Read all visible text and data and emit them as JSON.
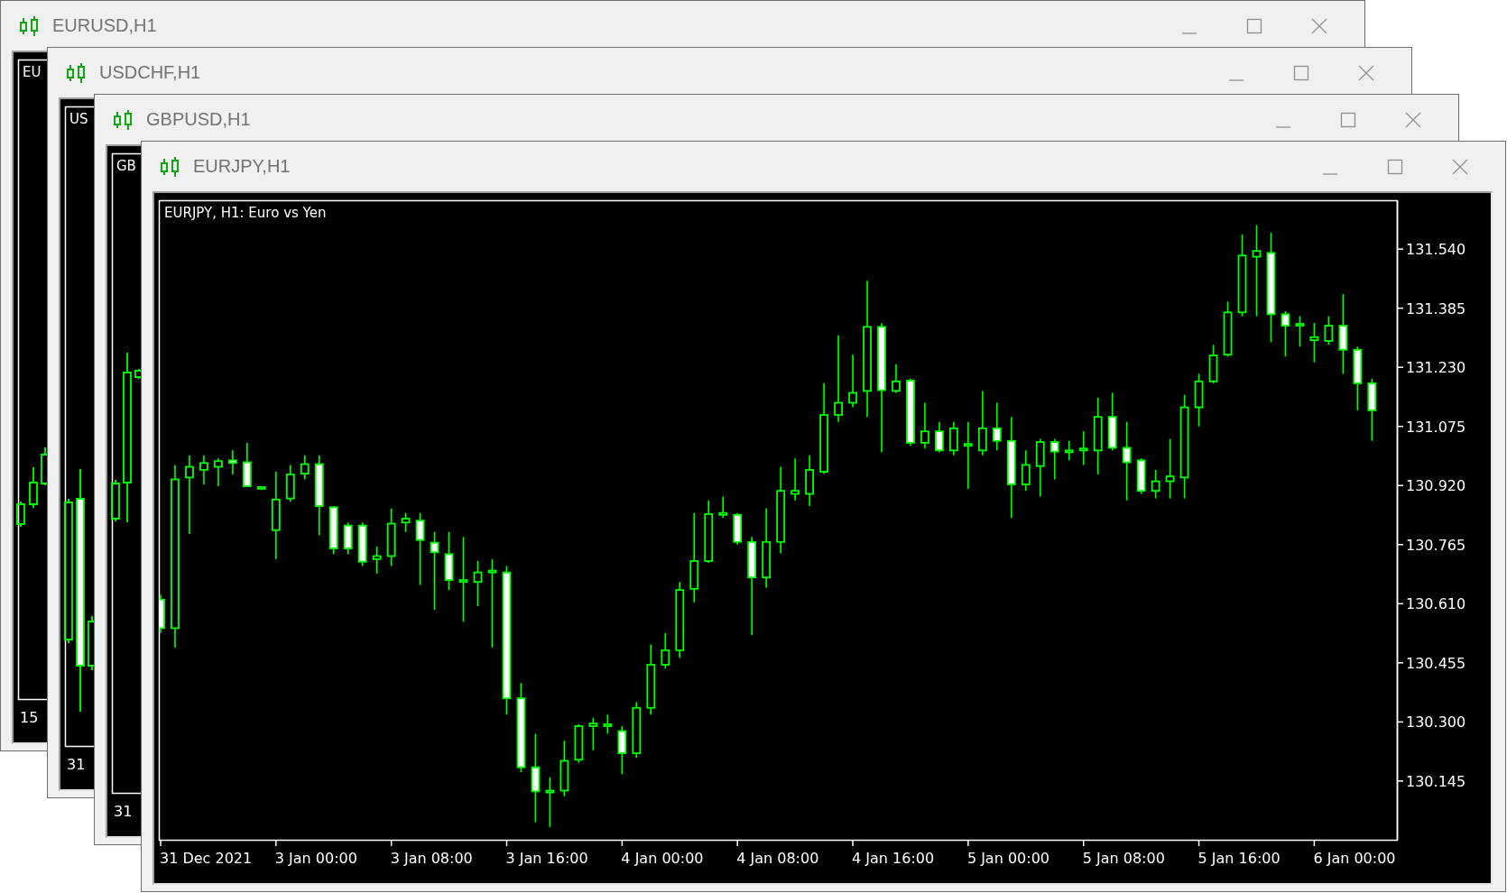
{
  "windows": [
    {
      "title": "EURUSD,H1",
      "chart_label": "EU",
      "date_label": "15"
    },
    {
      "title": "USDCHF,H1",
      "chart_label": "US",
      "date_label": "31"
    },
    {
      "title": "GBPUSD,H1",
      "chart_label": "GB",
      "date_label": "31"
    },
    {
      "title": "EURJPY,H1",
      "time_labels": [
        "31 Dec 2021",
        "3 Jan 00:00",
        "3 Jan 08:00",
        "3 Jan 16:00",
        "4 Jan 00:00",
        "4 Jan 08:00",
        "4 Jan 16:00",
        "5 Jan 00:00",
        "5 Jan 08:00",
        "5 Jan 16:00",
        "6 Jan 00:00"
      ],
      "chart_data": {
        "type": "candlestick",
        "title": "EURJPY, H1: Euro vs Yen",
        "ylim": [
          129.991,
          131.668
        ],
        "yticks": [
          {
            "value": 131.54,
            "label": "131.540"
          },
          {
            "value": 131.385,
            "label": "131.385"
          },
          {
            "value": 131.23,
            "label": "131.230"
          },
          {
            "value": 131.075,
            "label": "131.075"
          },
          {
            "value": 130.92,
            "label": "130.920"
          },
          {
            "value": 130.765,
            "label": "130.765"
          },
          {
            "value": 130.61,
            "label": "130.610"
          },
          {
            "value": 130.455,
            "label": "130.455"
          },
          {
            "value": 130.3,
            "label": "130.300"
          },
          {
            "value": 130.145,
            "label": "130.145"
          }
        ],
        "categories": [
          null,
          null,
          null,
          null,
          null,
          null,
          null,
          null,
          null,
          null,
          null,
          null,
          null,
          null,
          null,
          null,
          null,
          null,
          null,
          null,
          null,
          null,
          null,
          null,
          null,
          null,
          null,
          null,
          null,
          null,
          null,
          null,
          null,
          null,
          null,
          null,
          null,
          null,
          null,
          null,
          null,
          null,
          null,
          null,
          null,
          null,
          null,
          null,
          null,
          null,
          null,
          null,
          null,
          null,
          null,
          null,
          null,
          null,
          null,
          null,
          null,
          null,
          null,
          null,
          null,
          null,
          null,
          null,
          null,
          null,
          null,
          null,
          null,
          null,
          null,
          null,
          null,
          null,
          null,
          null,
          null,
          null,
          null,
          null,
          null
        ],
        "ohlc": [
          [
            130.621,
            130.634,
            130.533,
            130.546
          ],
          [
            130.546,
            130.974,
            130.495,
            130.936
          ],
          [
            130.941,
            130.999,
            130.793,
            130.969
          ],
          [
            130.961,
            130.999,
            130.923,
            130.979
          ],
          [
            130.969,
            130.991,
            130.918,
            130.984
          ],
          [
            130.986,
            131.012,
            130.949,
            130.979
          ],
          [
            130.981,
            131.032,
            130.916,
            130.918
          ],
          [
            130.916,
            130.918,
            130.913,
            130.916
          ],
          [
            130.803,
            130.956,
            130.727,
            130.883
          ],
          [
            130.886,
            130.974,
            130.878,
            130.949
          ],
          [
            130.951,
            130.999,
            130.936,
            130.976
          ],
          [
            130.976,
            130.999,
            130.79,
            130.866
          ],
          [
            130.863,
            130.866,
            130.74,
            130.755
          ],
          [
            130.815,
            130.823,
            130.74,
            130.755
          ],
          [
            130.815,
            130.823,
            130.709,
            130.72
          ],
          [
            130.727,
            130.76,
            130.689,
            130.735
          ],
          [
            130.735,
            130.86,
            130.709,
            130.82
          ],
          [
            130.823,
            130.848,
            130.798,
            130.833
          ],
          [
            130.828,
            130.848,
            130.659,
            130.777
          ],
          [
            130.77,
            130.798,
            130.594,
            130.745
          ],
          [
            130.74,
            130.798,
            130.646,
            130.672
          ],
          [
            130.667,
            130.785,
            130.563,
            130.672
          ],
          [
            130.667,
            130.722,
            130.604,
            130.692
          ],
          [
            130.692,
            130.727,
            130.495,
            130.697
          ],
          [
            130.692,
            130.709,
            130.319,
            130.362
          ],
          [
            130.362,
            130.402,
            130.168,
            130.181
          ],
          [
            130.181,
            130.269,
            130.037,
            130.118
          ],
          [
            130.115,
            130.155,
            130.024,
            130.12
          ],
          [
            130.12,
            130.251,
            130.105,
            130.198
          ],
          [
            130.201,
            130.294,
            130.193,
            130.289
          ],
          [
            130.289,
            130.311,
            130.226,
            130.296
          ],
          [
            130.289,
            130.319,
            130.269,
            130.294
          ],
          [
            130.276,
            130.289,
            130.163,
            130.218
          ],
          [
            130.218,
            130.352,
            130.206,
            130.337
          ],
          [
            130.337,
            130.503,
            130.319,
            130.45
          ],
          [
            130.45,
            130.533,
            130.44,
            130.488
          ],
          [
            130.488,
            130.667,
            130.468,
            130.646
          ],
          [
            130.649,
            130.848,
            130.614,
            130.722
          ],
          [
            130.722,
            130.881,
            130.717,
            130.845
          ],
          [
            130.843,
            130.891,
            130.835,
            130.848
          ],
          [
            130.843,
            130.848,
            130.765,
            130.772
          ],
          [
            130.772,
            130.785,
            130.528,
            130.679
          ],
          [
            130.679,
            130.86,
            130.652,
            130.772
          ],
          [
            130.772,
            130.969,
            130.742,
            130.906
          ],
          [
            130.898,
            130.991,
            130.881,
            130.906
          ],
          [
            130.898,
            130.999,
            130.866,
            130.961
          ],
          [
            130.956,
            131.188,
            130.951,
            131.105
          ],
          [
            131.105,
            131.314,
            131.087,
            131.137
          ],
          [
            131.137,
            131.263,
            131.125,
            131.163
          ],
          [
            131.168,
            131.457,
            131.1,
            131.336
          ],
          [
            131.336,
            131.346,
            131.007,
            131.17
          ],
          [
            131.168,
            131.238,
            131.163,
            131.193
          ],
          [
            131.195,
            131.2,
            131.024,
            131.032
          ],
          [
            131.032,
            131.137,
            131.017,
            131.062
          ],
          [
            131.062,
            131.087,
            131.007,
            131.012
          ],
          [
            131.012,
            131.087,
            130.999,
            131.07
          ],
          [
            131.024,
            131.087,
            130.911,
            131.029
          ],
          [
            131.012,
            131.168,
            130.999,
            131.07
          ],
          [
            131.07,
            131.137,
            131.012,
            131.037
          ],
          [
            131.037,
            131.1,
            130.835,
            130.923
          ],
          [
            130.923,
            131.012,
            130.906,
            130.974
          ],
          [
            130.971,
            131.042,
            130.891,
            131.034
          ],
          [
            131.034,
            131.042,
            130.936,
            131.009
          ],
          [
            131.007,
            131.037,
            130.986,
            131.012
          ],
          [
            131.012,
            131.062,
            130.974,
            131.017
          ],
          [
            131.012,
            131.15,
            130.949,
            131.1
          ],
          [
            131.1,
            131.163,
            131.012,
            131.019
          ],
          [
            131.019,
            131.087,
            130.881,
            130.981
          ],
          [
            130.986,
            130.991,
            130.898,
            130.906
          ],
          [
            130.906,
            130.961,
            130.886,
            130.931
          ],
          [
            130.931,
            131.042,
            130.886,
            130.944
          ],
          [
            130.941,
            131.158,
            130.886,
            131.125
          ],
          [
            131.125,
            131.213,
            131.075,
            131.193
          ],
          [
            131.193,
            131.289,
            131.188,
            131.261
          ],
          [
            131.263,
            131.402,
            131.258,
            131.374
          ],
          [
            131.374,
            131.578,
            131.364,
            131.523
          ],
          [
            131.52,
            131.603,
            131.364,
            131.535
          ],
          [
            131.53,
            131.583,
            131.296,
            131.369
          ],
          [
            131.369,
            131.377,
            131.258,
            131.339
          ],
          [
            131.339,
            131.364,
            131.284,
            131.344
          ],
          [
            131.301,
            131.346,
            131.243,
            131.309
          ],
          [
            131.299,
            131.364,
            131.289,
            131.339
          ],
          [
            131.339,
            131.422,
            131.213,
            131.276
          ],
          [
            131.276,
            131.284,
            131.117,
            131.188
          ],
          [
            131.188,
            131.2,
            131.037,
            131.117
          ]
        ]
      }
    }
  ]
}
